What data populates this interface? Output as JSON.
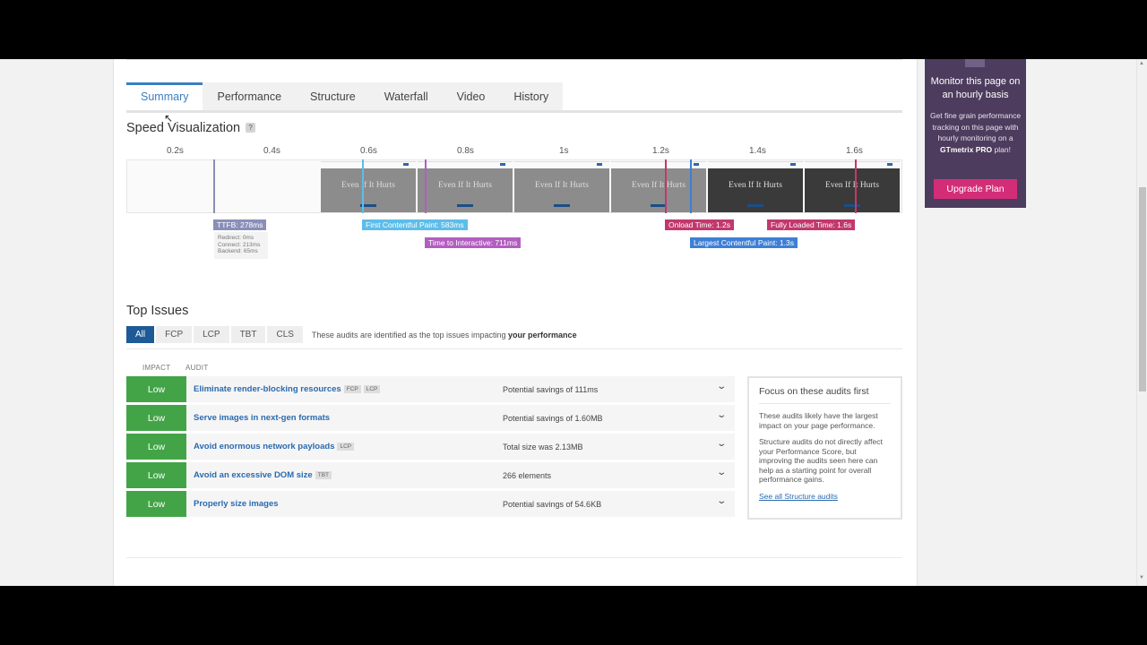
{
  "tabs": [
    "Summary",
    "Performance",
    "Structure",
    "Waterfall",
    "Video",
    "History"
  ],
  "speed_viz": {
    "title": "Speed Visualization",
    "help": "?",
    "ticks": [
      "0.2s",
      "0.4s",
      "0.6s",
      "0.8s",
      "1s",
      "1.2s",
      "1.4s",
      "1.6s"
    ],
    "frame_text": "Even If It Hurts",
    "markers": {
      "ttfb": "TTFB: 278ms",
      "fcp": "First Contentful Paint: 583ms",
      "tti": "Time to Interactive: 711ms",
      "onload": "Onload Time: 1.2s",
      "fully_loaded": "Fully Loaded Time: 1.6s",
      "lcp": "Largest Contentful Paint: 1.3s"
    },
    "ttfb_detail": [
      "Redirect: 0ms",
      "Connect: 213ms",
      "Backend: 65ms"
    ],
    "colors": {
      "ttfb": "#8a8fb8",
      "fcp": "#5dbde9",
      "tti": "#b35ec1",
      "onload": "#c2386d",
      "lcp": "#3e7fd6"
    }
  },
  "top_issues": {
    "title": "Top Issues",
    "filters": [
      "All",
      "FCP",
      "LCP",
      "TBT",
      "CLS"
    ],
    "note_prefix": "These audits are identified as the top issues impacting ",
    "note_bold": "your performance",
    "col_impact": "IMPACT",
    "col_audit": "AUDIT",
    "audits": [
      {
        "impact": "Low",
        "name": "Eliminate render-blocking resources",
        "tags": [
          "FCP",
          "LCP"
        ],
        "value": "Potential savings of 111ms"
      },
      {
        "impact": "Low",
        "name": "Serve images in next-gen formats",
        "tags": [],
        "value": "Potential savings of 1.60MB"
      },
      {
        "impact": "Low",
        "name": "Avoid enormous network payloads",
        "tags": [
          "LCP"
        ],
        "value": "Total size was 2.13MB"
      },
      {
        "impact": "Low",
        "name": "Avoid an excessive DOM size",
        "tags": [
          "TBT"
        ],
        "value": "266 elements"
      },
      {
        "impact": "Low",
        "name": "Properly size images",
        "tags": [],
        "value": "Potential savings of 54.6KB"
      }
    ],
    "focus": {
      "title": "Focus on these audits first",
      "p1": "These audits likely have the largest impact on your page performance.",
      "p2": "Structure audits do not directly affect your Performance Score, but improving the audits seen here can help as a starting point for overall performance gains.",
      "link": "See all Structure audits"
    }
  },
  "promo": {
    "title": "Monitor this page on an hourly basis",
    "text_prefix": "Get fine grain performance tracking on this page with hourly monitoring on a ",
    "text_bold": "GTmetrix PRO",
    "text_suffix": " plan!",
    "button": "Upgrade Plan"
  }
}
